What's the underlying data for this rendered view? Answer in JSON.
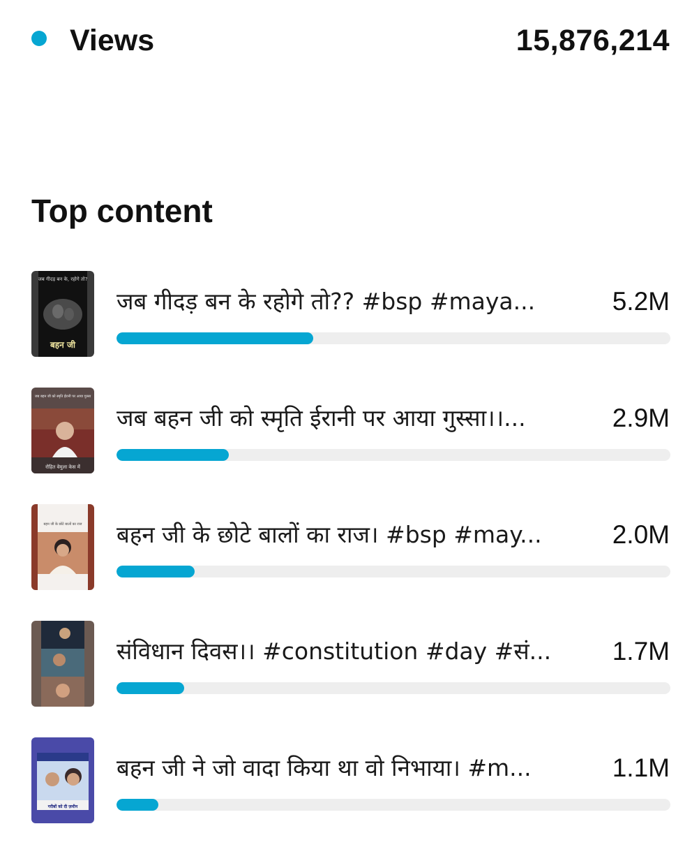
{
  "summary": {
    "metric_label": "Views",
    "metric_value": "15,876,214",
    "accent_color": "#06A6D2"
  },
  "top_content": {
    "title": "Top content",
    "items": [
      {
        "title": "जब गीदड़ बन के रहोगे तो?? #bsp #maya...",
        "views": "5.2M",
        "share": 0.355,
        "thumbnail": {
          "caption_top": "जब गीदड़ बन के, रहोगे तो?",
          "caption_bottom": "बहन जी"
        }
      },
      {
        "title": "जब बहन जी को स्मृति ईरानी पर आया गुस्सा।।...",
        "views": "2.9M",
        "share": 0.203,
        "thumbnail": {
          "caption_top": "जब बहन जी को स्मृति ईरानी पर आया गुस्सा",
          "caption_bottom": "रोहित वेमुला केस में"
        }
      },
      {
        "title": "बहन जी के छोटे बालों का राज। #bsp #may...",
        "views": "2.0M",
        "share": 0.141,
        "thumbnail": {
          "caption_top": "बहन जी के छोटे बालों का राज"
        }
      },
      {
        "title": "संविधान दिवस।। #constitution #day #सं...",
        "views": "1.7M",
        "share": 0.122
      },
      {
        "title": "बहन जी ने जो वादा किया था वो निभाया। #m...",
        "views": "1.1M",
        "share": 0.075,
        "thumbnail": {
          "caption_bottom": "गरीबों को दी ज़मीन"
        }
      }
    ]
  }
}
